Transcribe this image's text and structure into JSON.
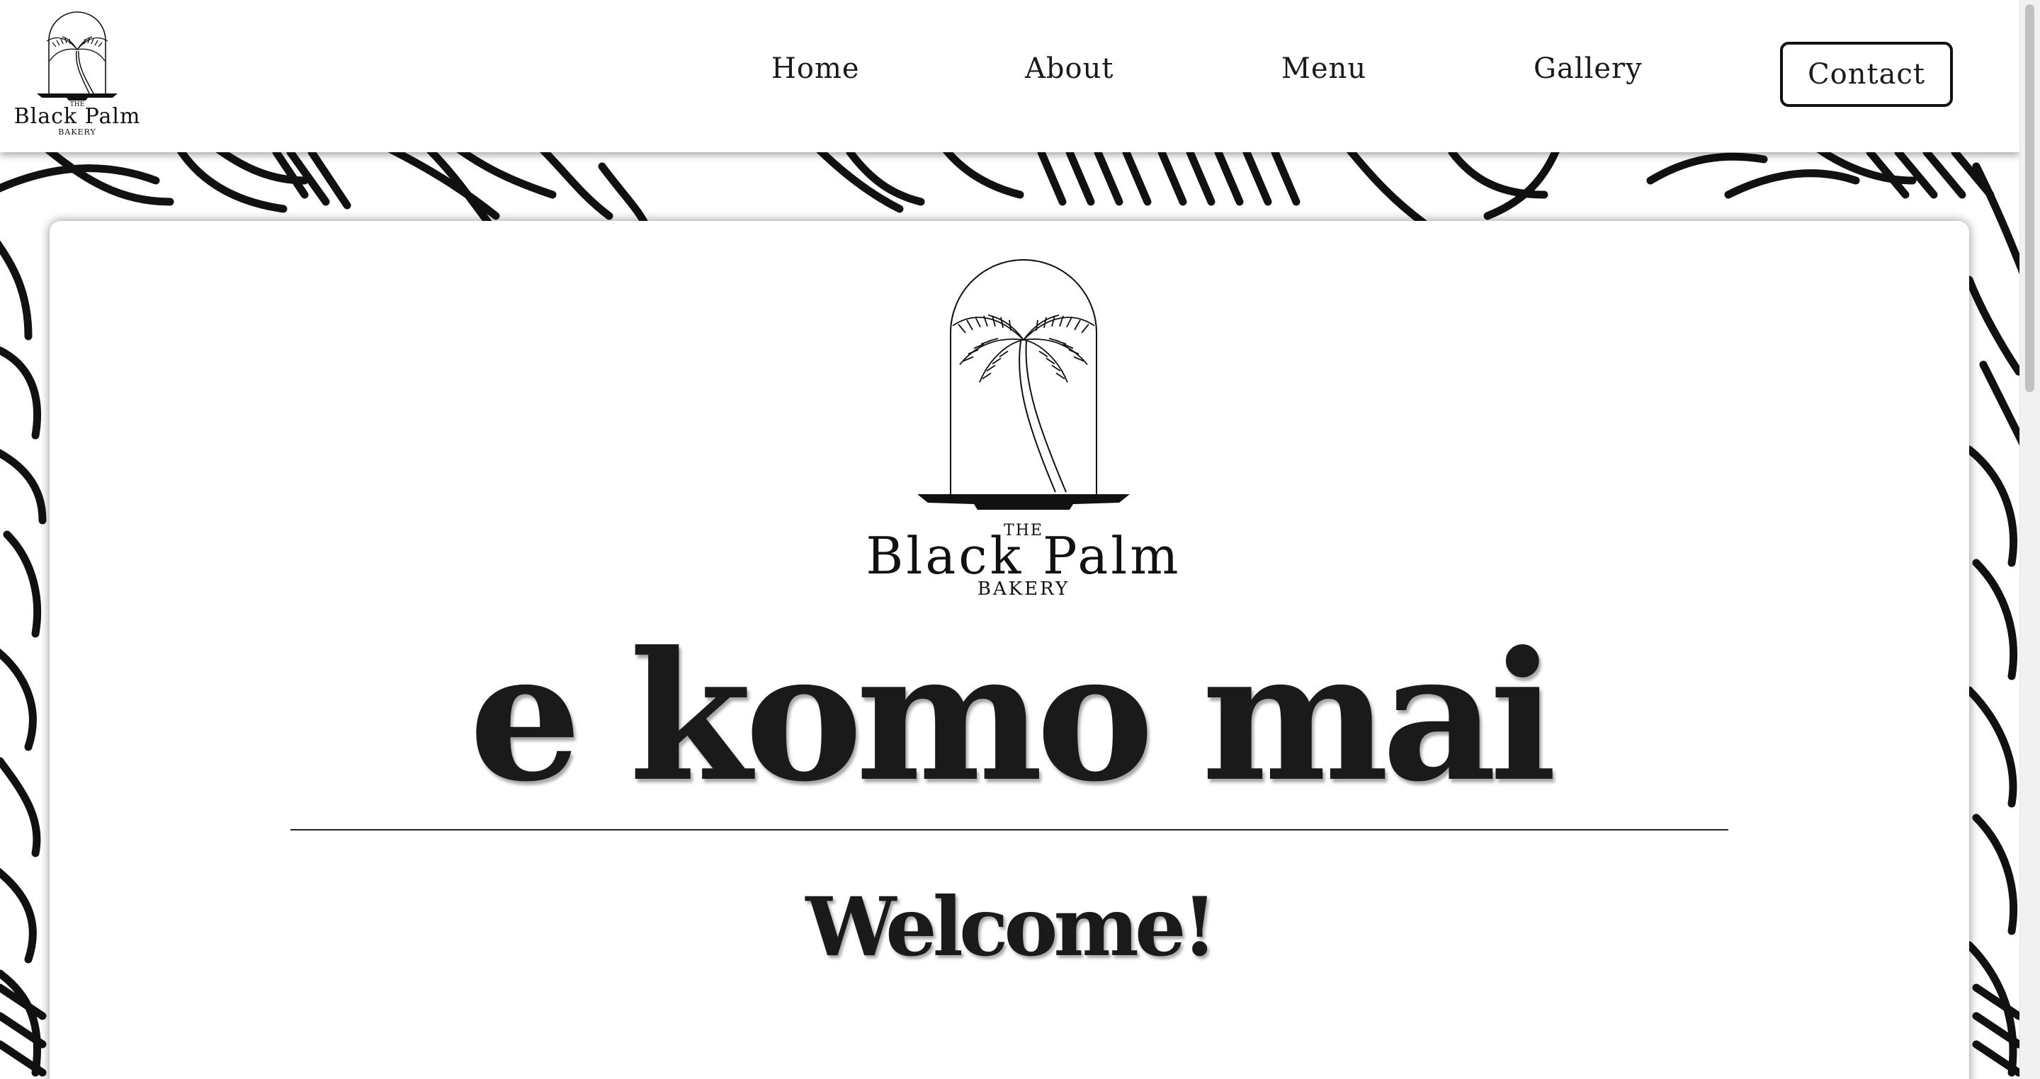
{
  "brand": {
    "the": "THE",
    "name": "Black Palm",
    "bakery": "BAKERY"
  },
  "nav": {
    "home": "Home",
    "about": "About",
    "menu": "Menu",
    "gallery": "Gallery",
    "contact": "Contact"
  },
  "hero": {
    "title": "e komo mai",
    "subtitle": "Welcome!"
  },
  "colors": {
    "ink": "#1a1a1a",
    "background": "#ffffff"
  },
  "icons": {
    "logo": "palm-tree-dome-icon",
    "background": "tropical-leaf-pattern"
  }
}
